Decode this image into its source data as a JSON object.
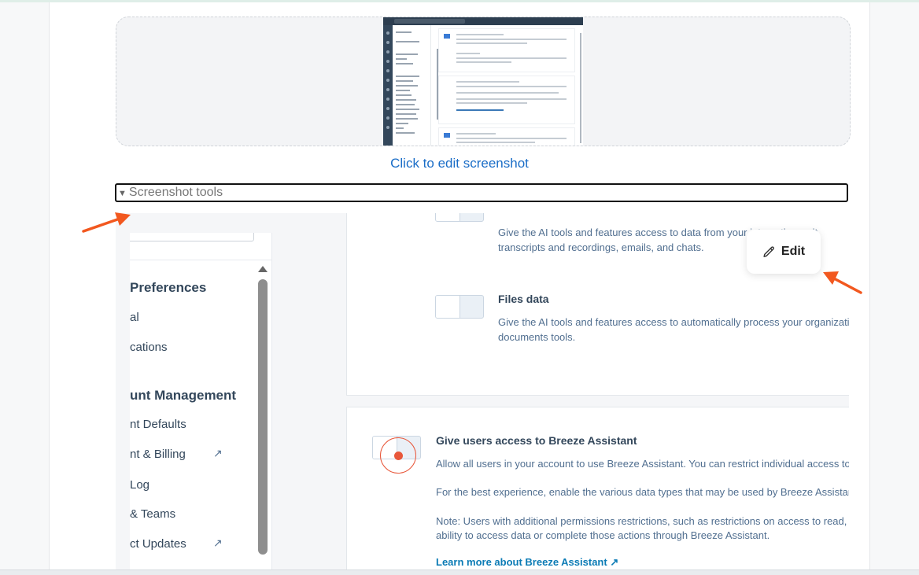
{
  "thumbnail": {
    "link_text": "Click to edit screenshot"
  },
  "tools": {
    "toggle_glyph": "▼",
    "label": "Screenshot tools"
  },
  "sidebar": {
    "items": [
      {
        "text": "Preferences",
        "type": "heading"
      },
      {
        "text": "al",
        "type": "item"
      },
      {
        "text": "cations",
        "type": "item"
      },
      {
        "text": "unt Management",
        "type": "heading"
      },
      {
        "text": "nt Defaults",
        "type": "item"
      },
      {
        "text": "nt & Billing",
        "type": "item",
        "external": true
      },
      {
        "text": "Log",
        "type": "item"
      },
      {
        "text": "& Teams",
        "type": "item"
      },
      {
        "text": "ct Updates",
        "type": "item",
        "external": true
      }
    ]
  },
  "cards": {
    "conversation": {
      "desc_1": "Give the AI tools and features access to data from your interactions wit",
      "desc_2": "transcripts and recordings, emails, and chats."
    },
    "files": {
      "title": "Files data",
      "desc_1": "Give the AI tools and features access to automatically process your organization's public",
      "desc_2": "documents tools."
    },
    "breeze": {
      "title": "Give users access to Breeze Assistant",
      "line_1": "Allow all users in your account to use Breeze Assistant. You can restrict individual access to Breeze Ass",
      "line_2": "For the best experience, enable the various data types that may be used by Breeze Assistant.",
      "line_3": "Note: Users with additional permissions restrictions, such as restrictions on access to read, create, and",
      "line_4": "ability to access data or complete those actions through Breeze Assistant.",
      "link": "Learn more about Breeze Assistant"
    }
  },
  "edit_button": {
    "label": "Edit",
    "icon": "pencil-icon"
  },
  "colors": {
    "arrow": "#f2581f",
    "link_blue": "#1a6dc7",
    "target_orange": "#e8573a"
  }
}
